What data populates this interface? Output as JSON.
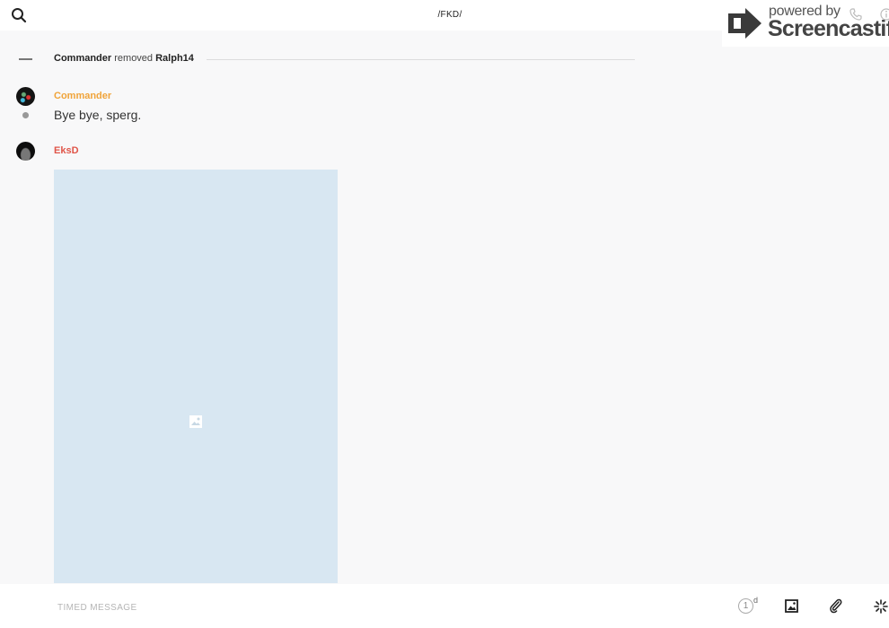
{
  "header": {
    "title": "/FKD/"
  },
  "watermark": {
    "powered": "powered by",
    "brand": "Screencastify"
  },
  "system_message": {
    "actor": "Commander",
    "action": "removed",
    "target": "Ralph14"
  },
  "messages": [
    {
      "author": "Commander",
      "author_color": "#f0a43a",
      "text": "Bye bye, sperg."
    },
    {
      "author": "EksD",
      "author_color": "#e05549",
      "attachment": "image"
    }
  ],
  "composer": {
    "placeholder": "TIMED MESSAGE",
    "timer_value": "1",
    "timer_unit": "d"
  },
  "icons": [
    "search-icon",
    "phone-icon",
    "info-icon",
    "image-icon",
    "photo-icon",
    "paperclip-icon",
    "sparkle-icon"
  ],
  "colors": {
    "image_placeholder": "#d8e7f2",
    "background": "#f8f8f9"
  }
}
